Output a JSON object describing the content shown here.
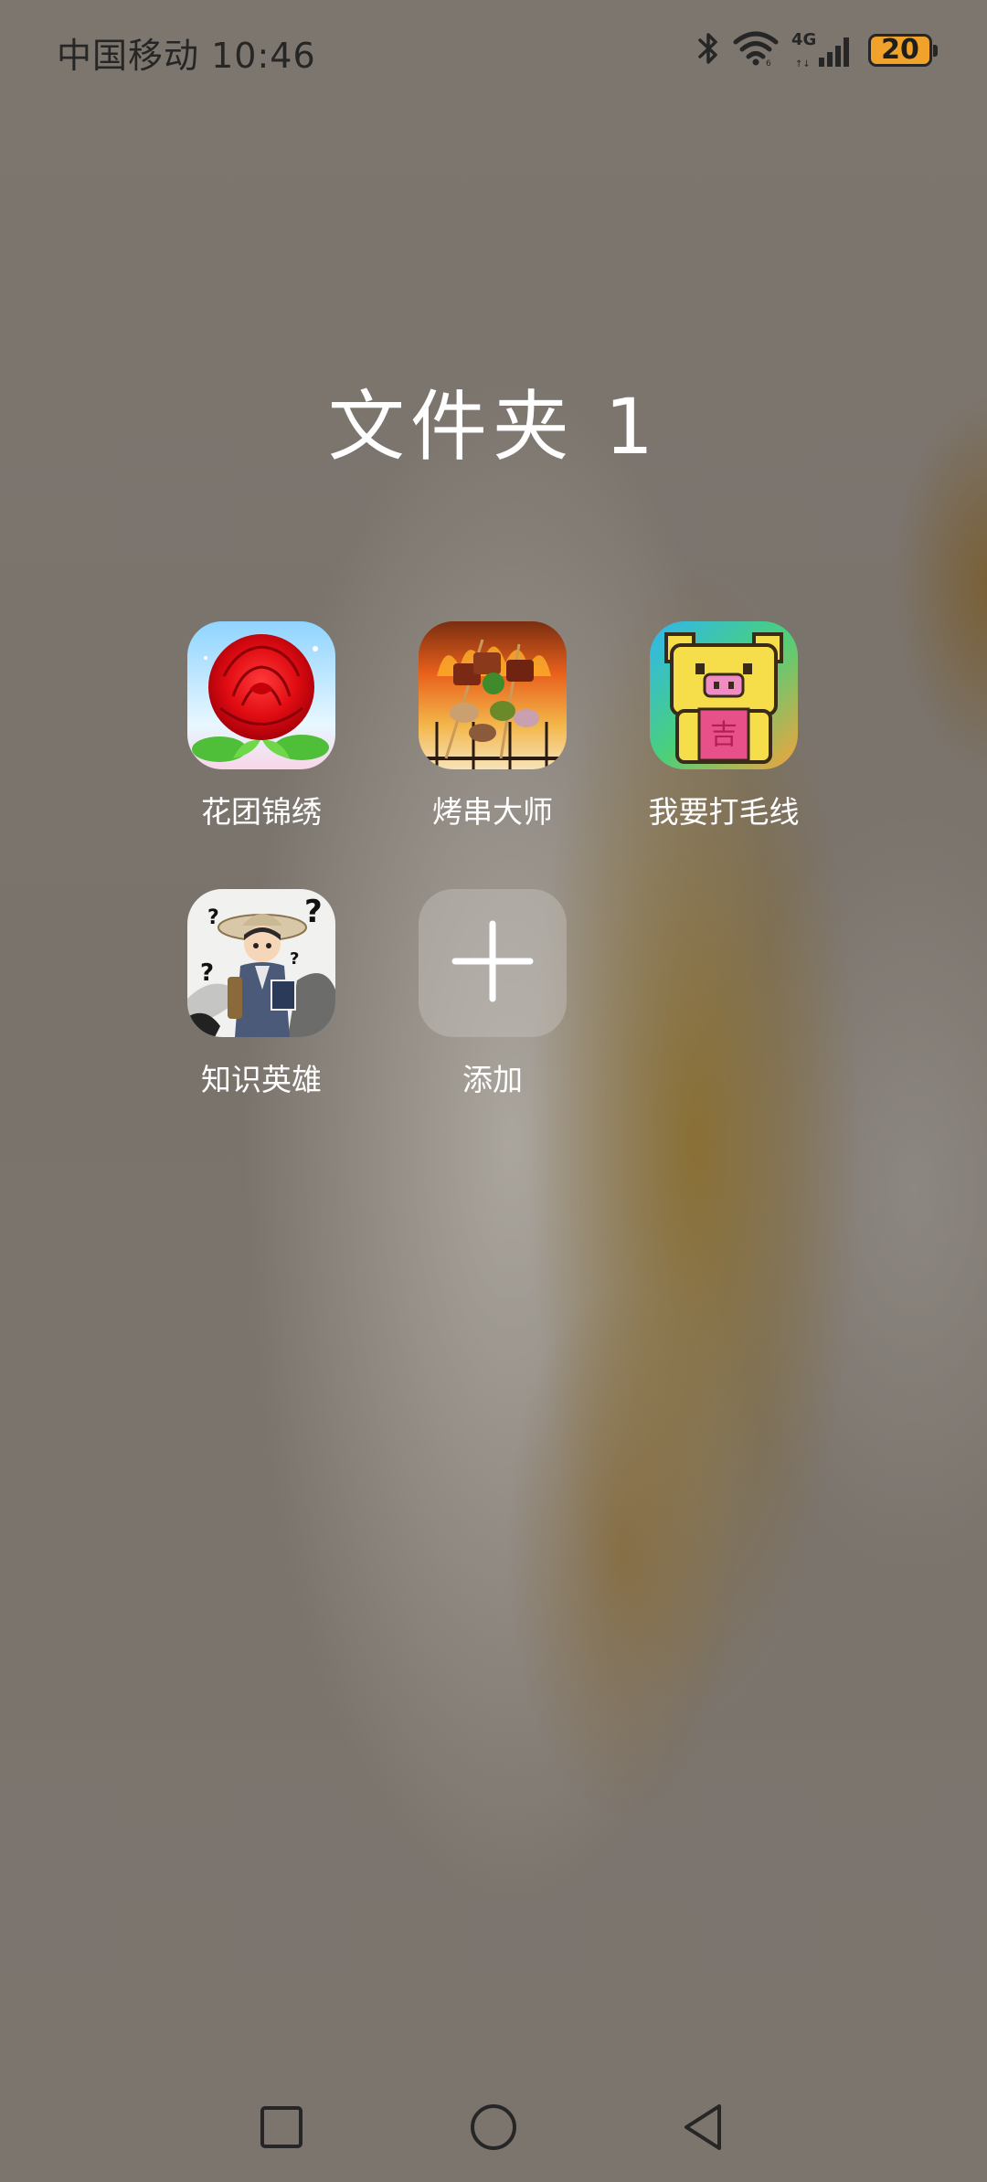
{
  "status_bar": {
    "carrier": "中国移动",
    "time": "10:46",
    "network_type": "4G",
    "battery_level": "20",
    "icons": [
      "bluetooth-icon",
      "wifi-icon",
      "cellular-signal-icon",
      "battery-icon"
    ],
    "battery_color": "#f0a22a"
  },
  "folder": {
    "title": "文件夹 1"
  },
  "apps": [
    {
      "label": "花团锦绣",
      "icon": "rose-app-icon"
    },
    {
      "label": "烤串大师",
      "icon": "skewer-app-icon"
    },
    {
      "label": "我要打毛线",
      "icon": "pixel-pig-app-icon"
    },
    {
      "label": "知识英雄",
      "icon": "scholar-app-icon"
    }
  ],
  "add_button": {
    "label": "添加",
    "icon": "plus-icon"
  },
  "nav_bar": {
    "icons": [
      "recents-square-icon",
      "home-circle-icon",
      "back-triangle-icon"
    ]
  }
}
